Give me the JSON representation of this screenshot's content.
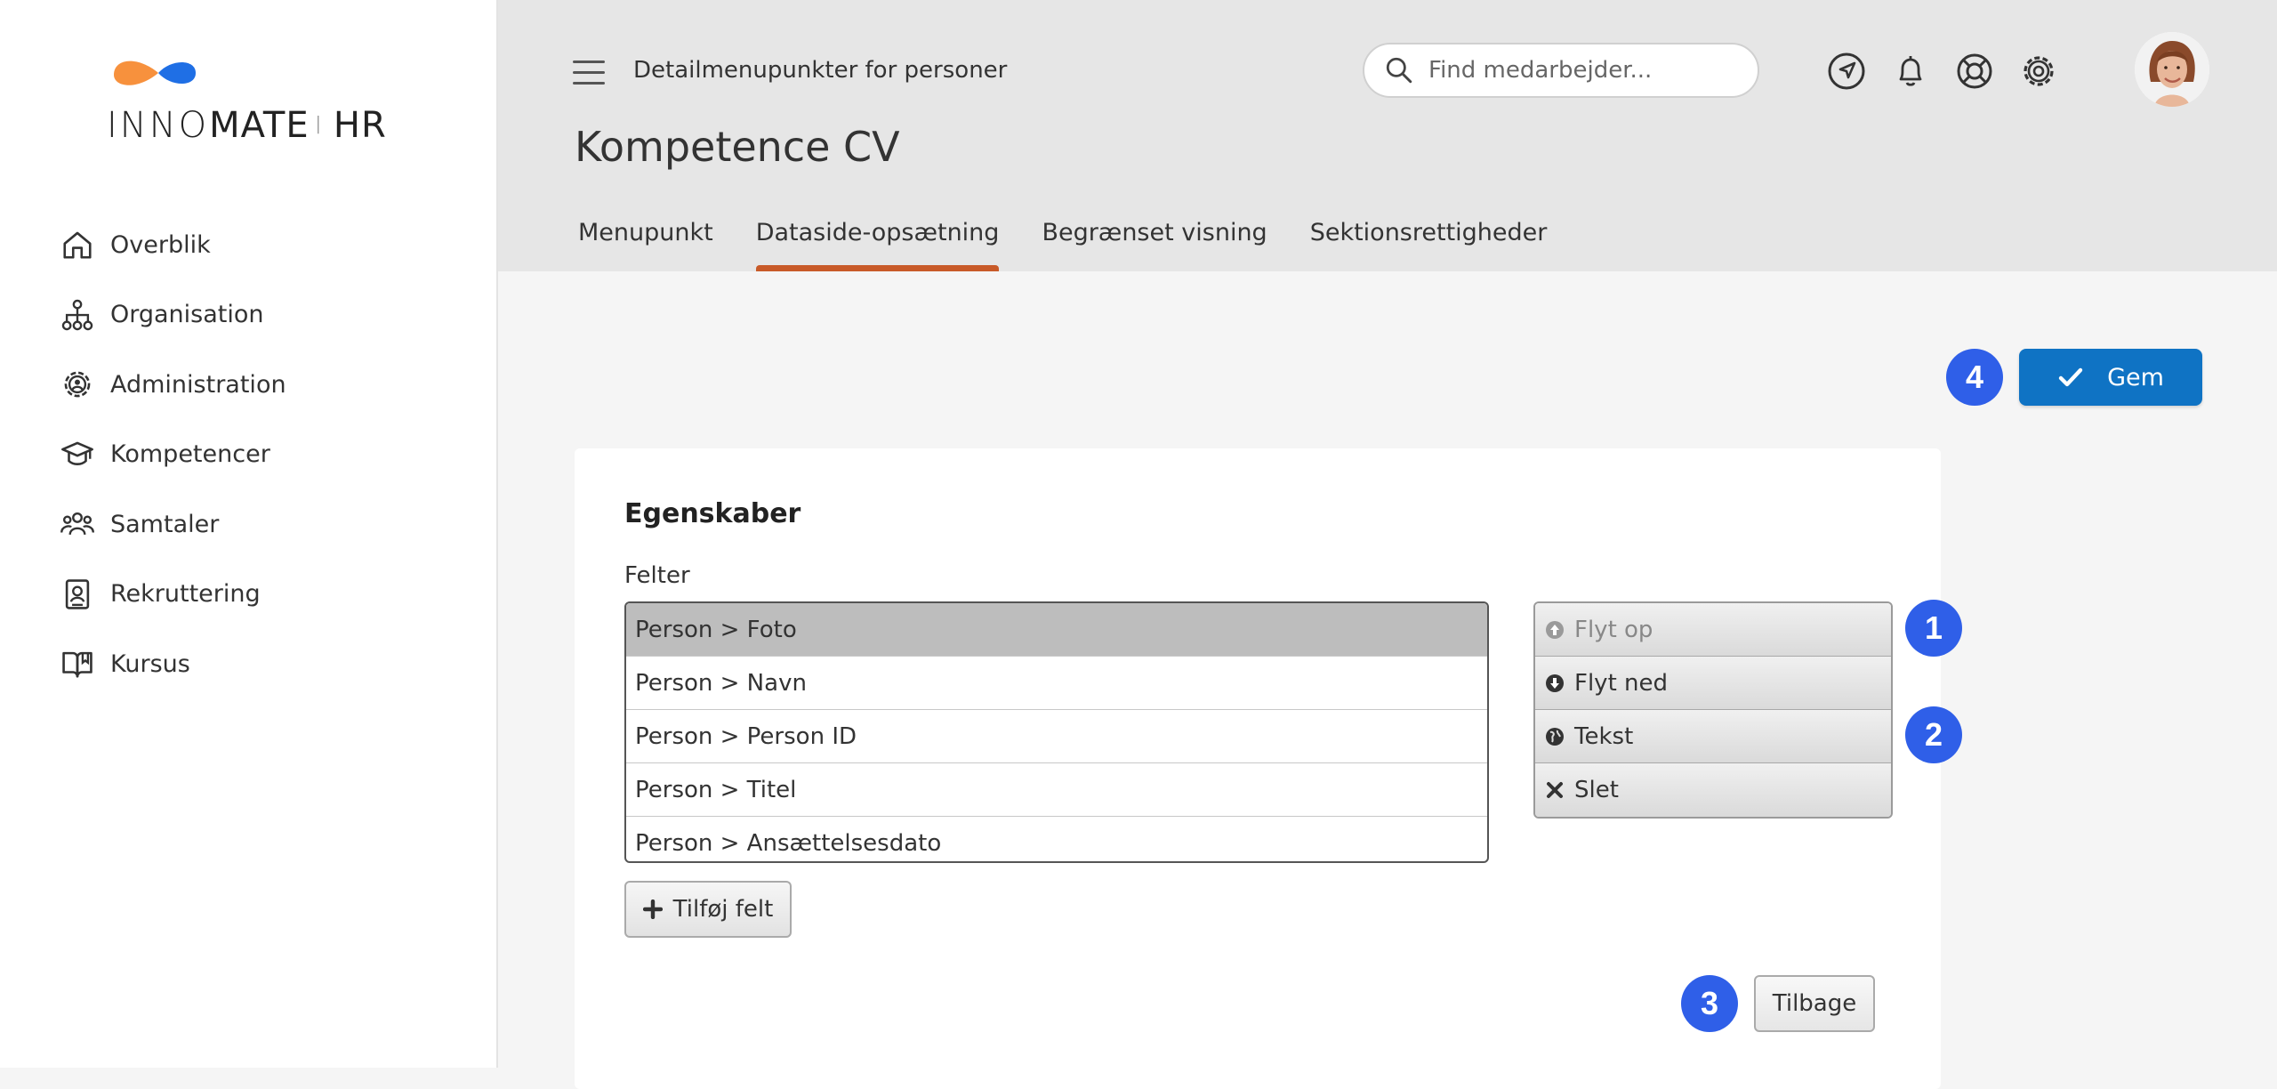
{
  "brand": {
    "logo_light": "INNO",
    "logo_bold": "MATE",
    "logo_sep": "I",
    "logo_suffix": "HR",
    "colors": {
      "orange": "#f7913d",
      "blue": "#1f6fe5"
    }
  },
  "sidebar": {
    "items": [
      {
        "label": "Overblik",
        "icon": "home-icon"
      },
      {
        "label": "Organisation",
        "icon": "org-chart-icon"
      },
      {
        "label": "Administration",
        "icon": "gear-user-icon"
      },
      {
        "label": "Kompetencer",
        "icon": "graduation-cap-icon"
      },
      {
        "label": "Samtaler",
        "icon": "people-icon"
      },
      {
        "label": "Rekruttering",
        "icon": "id-card-icon"
      },
      {
        "label": "Kursus",
        "icon": "book-icon"
      }
    ]
  },
  "header": {
    "breadcrumb": "Detailmenupunkter for personer",
    "search_placeholder": "Find medarbejder...",
    "icons": [
      "navigation-icon",
      "bell-icon",
      "help-lifebuoy-icon",
      "settings-icon"
    ],
    "page_title": "Kompetence CV",
    "tabs": [
      {
        "label": "Menupunkt",
        "active": false
      },
      {
        "label": "Dataside-opsætning",
        "active": true
      },
      {
        "label": "Begrænset visning",
        "active": false
      },
      {
        "label": "Sektionsrettigheder",
        "active": false
      }
    ],
    "accent": "#c85a28"
  },
  "save": {
    "label": "Gem",
    "badge": "4",
    "color": "#0f73c4"
  },
  "card": {
    "title": "Egenskaber",
    "field_label": "Felter",
    "fields": [
      "Person > Foto",
      "Person > Navn",
      "Person > Person ID",
      "Person > Titel",
      "Person > Ansættelsesdato"
    ],
    "actions": [
      {
        "label": "Flyt op",
        "icon": "arrow-up-circle-icon",
        "disabled": true
      },
      {
        "label": "Flyt ned",
        "icon": "arrow-down-circle-icon",
        "disabled": false
      },
      {
        "label": "Tekst",
        "icon": "globe-icon",
        "disabled": false
      },
      {
        "label": "Slet",
        "icon": "x-icon",
        "disabled": false
      }
    ],
    "add_label": "Tilføj felt",
    "back_label": "Tilbage",
    "badges": {
      "move": "1",
      "text": "2",
      "back": "3"
    }
  },
  "badge_color": "#2f5fe8"
}
